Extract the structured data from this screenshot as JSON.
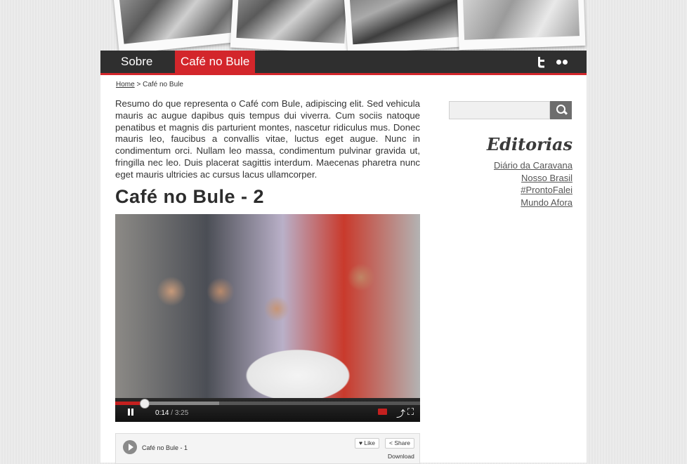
{
  "nav": {
    "items": [
      {
        "label": "Sobre",
        "active": false
      },
      {
        "label": "Café no Bule",
        "active": true
      }
    ],
    "social": [
      "twitter-icon",
      "flickr-icon"
    ],
    "accent_color": "#d3262b",
    "bar_color": "#2f2f2f"
  },
  "breadcrumb": {
    "home": "Home",
    "separator": ">",
    "current": "Café no Bule"
  },
  "intro": "Resumo do que representa o Café com Bule, adipiscing elit. Sed vehicula mauris ac augue dapibus quis tempus dui viverra. Cum sociis natoque penatibus et magnis dis parturient montes, nascetur ridiculus mus. Donec mauris leo, faucibus a convallis vitae, luctus eget augue. Nunc in condimentum orci. Nullam leo massa, condimentum pulvinar gravida ut, fringilla nec leo. Duis placerat sagittis interdum. Maecenas pharetra nunc eget mauris ultricies ac cursus lacus ullamcorper.",
  "post": {
    "title": "Café no Bule - 2"
  },
  "video": {
    "current_time": "0:14",
    "duration": "3:25",
    "progress_fraction": 0.095,
    "buffered_fraction": 0.34
  },
  "playlist": {
    "next_title": "Café no Bule - 1",
    "like_label": "Like",
    "share_label": "Share",
    "download_label": "Download"
  },
  "sidebar": {
    "search_placeholder": "",
    "heading": "Editorias",
    "links": [
      "Diário da Caravana",
      "Nosso Brasil",
      "#ProntoFalei",
      "Mundo Afora"
    ]
  }
}
